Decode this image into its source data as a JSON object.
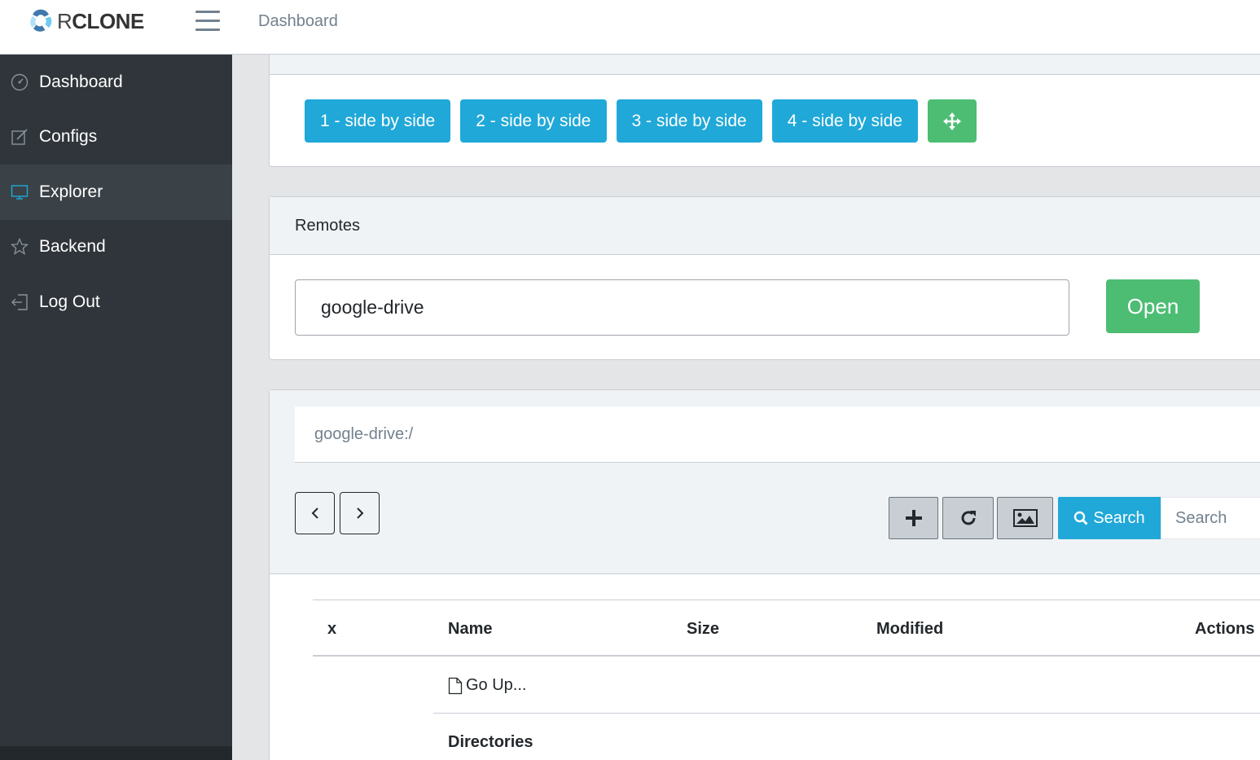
{
  "header": {
    "brand_text_r": "R",
    "brand_text_rest": "CLONE",
    "breadcrumb": "Dashboard"
  },
  "sidebar": {
    "items": [
      {
        "label": "Dashboard",
        "icon": "speedometer-icon",
        "active": false
      },
      {
        "label": "Configs",
        "icon": "note-icon",
        "active": false
      },
      {
        "label": "Explorer",
        "icon": "screen-desktop-icon",
        "active": true
      },
      {
        "label": "Backend",
        "icon": "star-icon",
        "active": false
      },
      {
        "label": "Log Out",
        "icon": "logout-icon",
        "active": false
      }
    ]
  },
  "layout_buttons": [
    "1 - side by side",
    "2 - side by side",
    "3 - side by side",
    "4 - side by side"
  ],
  "remotes": {
    "title": "Remotes",
    "input_value": "google-drive",
    "open_label": "Open"
  },
  "explorer": {
    "path": "google-drive:/",
    "search_button": "Search",
    "search_placeholder": "Search",
    "table": {
      "columns": [
        "x",
        "Name",
        "Size",
        "Modified",
        "Actions"
      ],
      "go_up": "Go Up...",
      "section": "Directories"
    }
  },
  "colors": {
    "primary_blue": "#20a8d8",
    "success_green": "#4dbd74",
    "sidebar_bg": "#2f353a"
  }
}
